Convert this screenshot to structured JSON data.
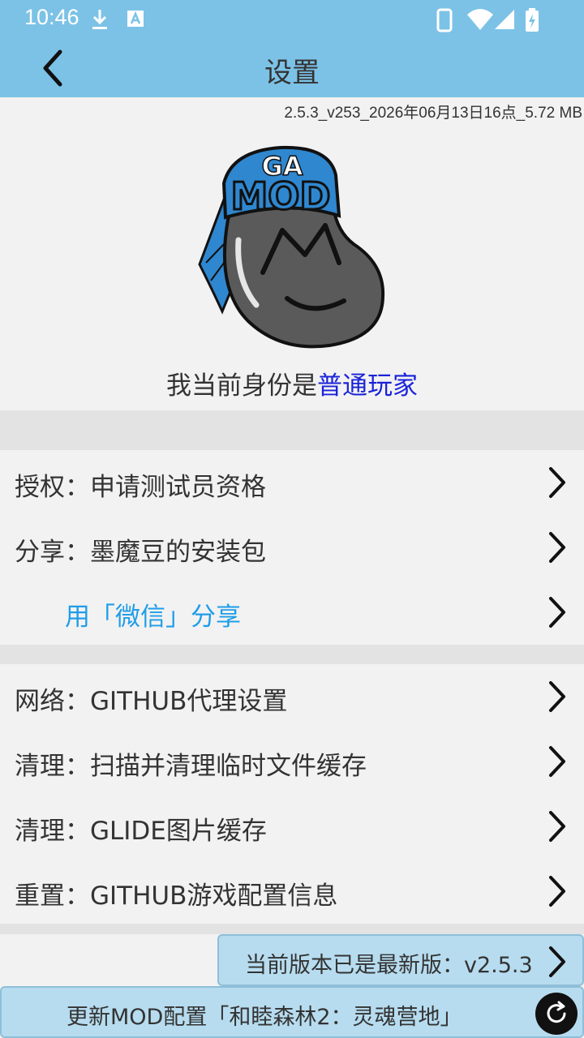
{
  "status_bar": {
    "time": "10:46"
  },
  "app_bar": {
    "title": "设置"
  },
  "header": {
    "version": "2.5.3_v253_2026年06月13日16点_5.72 MB",
    "logo_text": "GA MOD",
    "identity_prefix": "我当前身份是",
    "identity_role": "普通玩家"
  },
  "menu": {
    "group1": [
      {
        "label": "授权：申请测试员资格"
      },
      {
        "label": "分享：墨魔豆的安装包"
      },
      {
        "label": "用「微信」分享"
      }
    ],
    "group2": [
      {
        "label": "网络：GITHUB代理设置"
      },
      {
        "label": "清理：扫描并清理临时文件缓存"
      },
      {
        "label": "清理：GLIDE图片缓存"
      },
      {
        "label": "重置：GITHUB游戏配置信息"
      }
    ]
  },
  "footer": {
    "update_label": "当前版本已是最新版：v2.5.3",
    "config_label": "更新MOD配置「和睦森林2：灵魂营地」"
  },
  "colors": {
    "app_bar": "#7cc2e6",
    "role_link": "#1a23d8",
    "share_link": "#1f9de8",
    "footer_bg": "#b7dcef"
  },
  "icons": [
    "download-icon",
    "font-icon",
    "phone-icon",
    "wifi-icon",
    "signal-icon",
    "battery-icon",
    "back-icon",
    "chevron-right-icon",
    "refresh-icon"
  ]
}
